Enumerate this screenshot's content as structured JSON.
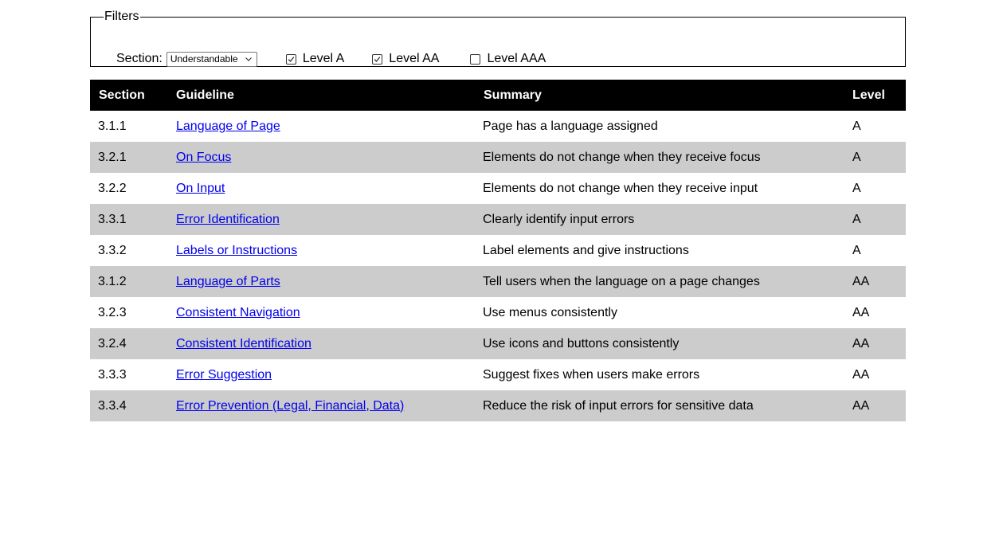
{
  "filters": {
    "legend": "Filters",
    "section_label": "Section:",
    "section_value": "Understandable",
    "levels": [
      {
        "label": "Level A",
        "checked": true
      },
      {
        "label": "Level AA",
        "checked": true
      },
      {
        "label": "Level AAA",
        "checked": false
      }
    ]
  },
  "table": {
    "headers": [
      "Section",
      "Guideline",
      "Summary",
      "Level"
    ],
    "rows": [
      {
        "section": "3.1.1",
        "guideline": "Language of Page",
        "summary": "Page has a language assigned",
        "level": "A"
      },
      {
        "section": "3.2.1",
        "guideline": "On Focus",
        "summary": "Elements do not change when they receive focus",
        "level": "A"
      },
      {
        "section": "3.2.2",
        "guideline": "On Input",
        "summary": "Elements do not change when they receive input",
        "level": "A"
      },
      {
        "section": "3.3.1",
        "guideline": "Error Identification",
        "summary": "Clearly identify input errors",
        "level": "A"
      },
      {
        "section": "3.3.2",
        "guideline": "Labels or Instructions",
        "summary": "Label elements and give instructions",
        "level": "A"
      },
      {
        "section": "3.1.2",
        "guideline": "Language of Parts",
        "summary": "Tell users when the language on a page changes",
        "level": "AA"
      },
      {
        "section": "3.2.3",
        "guideline": "Consistent Navigation",
        "summary": "Use menus consistently",
        "level": "AA"
      },
      {
        "section": "3.2.4",
        "guideline": "Consistent Identification",
        "summary": "Use icons and buttons consistently",
        "level": "AA"
      },
      {
        "section": "3.3.3",
        "guideline": "Error Suggestion",
        "summary": "Suggest fixes when users make errors",
        "level": "AA"
      },
      {
        "section": "3.3.4",
        "guideline": "Error Prevention (Legal, Financial, Data)",
        "summary": "Reduce the risk of input errors for sensitive data",
        "level": "AA"
      }
    ]
  },
  "colors": {
    "header_bg": "#000000",
    "header_text": "#ffffff",
    "stripe_bg": "#cccccc",
    "link": "#0000ee"
  },
  "icons": {
    "select": "chevron-down-icon",
    "checked": "checkmark-icon"
  }
}
